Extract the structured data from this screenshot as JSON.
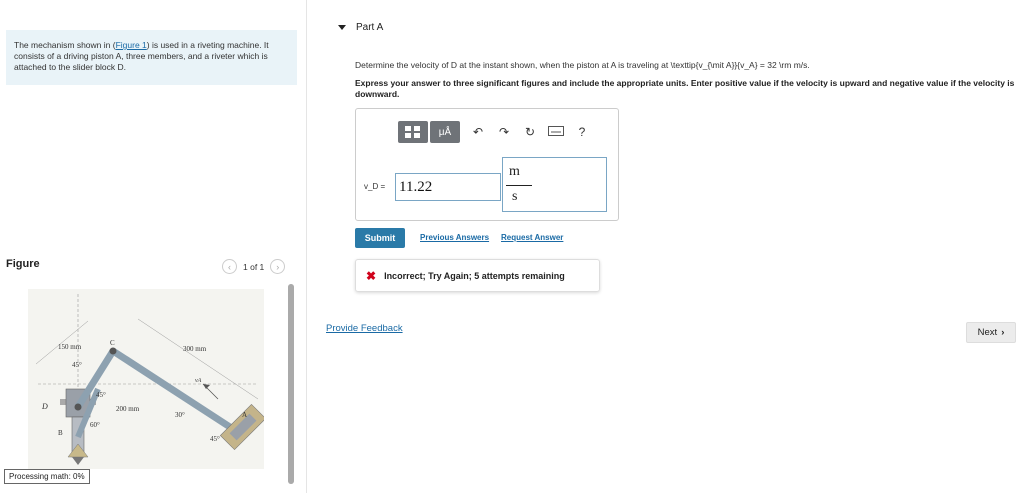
{
  "intro": {
    "text_before": "The mechanism shown in (",
    "figure_link": "Figure 1",
    "text_after": ") is used in a riveting machine. It consists of a driving piston A, three members, and a riveter which is attached to the slider block D."
  },
  "figure": {
    "title": "Figure",
    "pager": "1 of 1",
    "labels": {
      "d150": "150 mm",
      "d300": "300 mm",
      "d200": "200 mm",
      "a45a": "45°",
      "a45b": "45°",
      "a45c": "45°",
      "a60": "60°",
      "a30": "30°",
      "C": "C",
      "D": "D",
      "B": "B",
      "A": "A",
      "vA": "vA"
    }
  },
  "status": {
    "processing": "Processing math: 0%"
  },
  "part": {
    "title": "Part A",
    "question": "Determine the velocity of D at the instant shown, when the piston at A is traveling at \\texttip{v_{\\mit A}}{v_A} = 32 \\rm m/s.",
    "instructions": "Express your answer to three significant figures and include the appropriate units. Enter positive value if the velocity is upward and negative value if the velocity is downward."
  },
  "answer": {
    "variable_label": "v_D =",
    "value": "11.22",
    "unit_numerator": "m",
    "unit_denominator": "s"
  },
  "toolbar": {
    "template_icon": "template-icon",
    "mu_label": "μÅ",
    "undo_icon": "undo-icon",
    "redo_icon": "redo-icon",
    "reset_icon": "reset-icon",
    "keyboard_icon": "keyboard-icon",
    "help_label": "?"
  },
  "actions": {
    "submit": "Submit",
    "previous_answers": "Previous Answers",
    "request_answer": "Request Answer"
  },
  "feedback": {
    "message": "Incorrect; Try Again; 5 attempts remaining"
  },
  "footer": {
    "provide_feedback": "Provide Feedback",
    "next": "Next"
  }
}
